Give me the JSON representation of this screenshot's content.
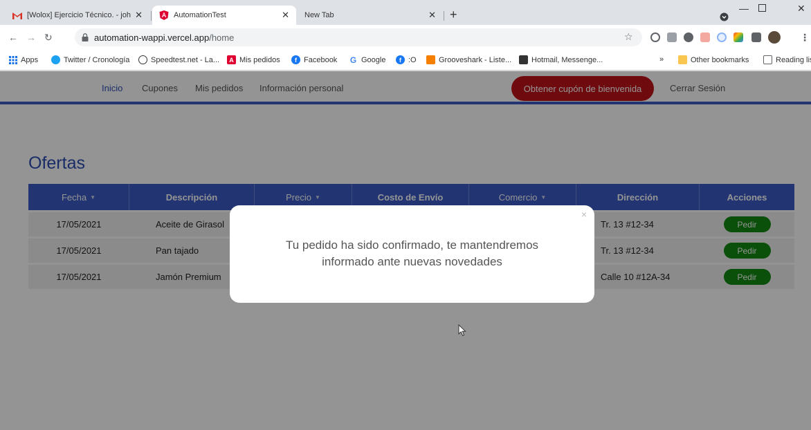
{
  "browser": {
    "tabs": [
      {
        "title": "[Wolox] Ejercicio Técnico. - johnd",
        "icon": "gmail-icon",
        "active": false
      },
      {
        "title": "AutomationTest",
        "icon": "angular-icon",
        "active": true
      },
      {
        "title": "New Tab",
        "icon": "",
        "active": false
      }
    ],
    "address": {
      "domain": "automation-wappi.vercel.app",
      "path": "/home"
    },
    "bookmarks": [
      {
        "label": "Apps",
        "icon": "apps-grid-icon"
      },
      {
        "label": "Twitter / Cronología",
        "icon": "twitter-icon"
      },
      {
        "label": "Speedtest.net - La...",
        "icon": "speedtest-icon"
      },
      {
        "label": "Mis pedidos",
        "icon": "angular-icon"
      },
      {
        "label": "Facebook",
        "icon": "facebook-icon"
      },
      {
        "label": "Google",
        "icon": "google-icon"
      },
      {
        "label": ":O",
        "icon": "facebook-icon"
      },
      {
        "label": "Grooveshark - Liste...",
        "icon": "grooveshark-icon"
      },
      {
        "label": "Hotmail, Messenge...",
        "icon": "msn-icon"
      }
    ],
    "bookmarks_overflow": "»",
    "other_bookmarks": "Other bookmarks",
    "reading_list": "Reading lis",
    "colors": {
      "tabstrip": "#dee1e6",
      "angular_red": "#dd0031",
      "gmail_red": "#d93025"
    }
  },
  "app": {
    "nav": {
      "links": [
        "Inicio",
        "Cupones",
        "Mis pedidos",
        "Información personal"
      ],
      "active_link": "Inicio",
      "coupon_button": "Obtener cupón de bienvenida",
      "logout": "Cerrar Sesión"
    },
    "section_title": "Ofertas",
    "table": {
      "columns": [
        {
          "label": "Fecha",
          "sortable": true
        },
        {
          "label": "Descripción",
          "sortable": false
        },
        {
          "label": "Precio",
          "sortable": true
        },
        {
          "label": "Costo de Envío",
          "sortable": false
        },
        {
          "label": "Comercio",
          "sortable": true
        },
        {
          "label": "Dirección",
          "sortable": false
        },
        {
          "label": "Acciones",
          "sortable": false
        }
      ],
      "rows": [
        {
          "fecha": "17/05/2021",
          "descripcion": "Aceite de Girasol",
          "direccion": "Tr. 13 #12-34",
          "accion": "Pedir"
        },
        {
          "fecha": "17/05/2021",
          "descripcion": "Pan tajado",
          "direccion": "Tr. 13 #12-34",
          "accion": "Pedir"
        },
        {
          "fecha": "17/05/2021",
          "descripcion": "Jamón Premium",
          "direccion": "Calle 10 #12A-34",
          "accion": "Pedir"
        }
      ]
    },
    "modal": {
      "close": "×",
      "message_line1": "Tu pedido ha sido confirmado, te mantendremos",
      "message_line2": "informado ante nuevas novedades"
    },
    "colors": {
      "primary": "#3b5cc4",
      "danger": "#c0141a",
      "success": "#128a12"
    }
  }
}
